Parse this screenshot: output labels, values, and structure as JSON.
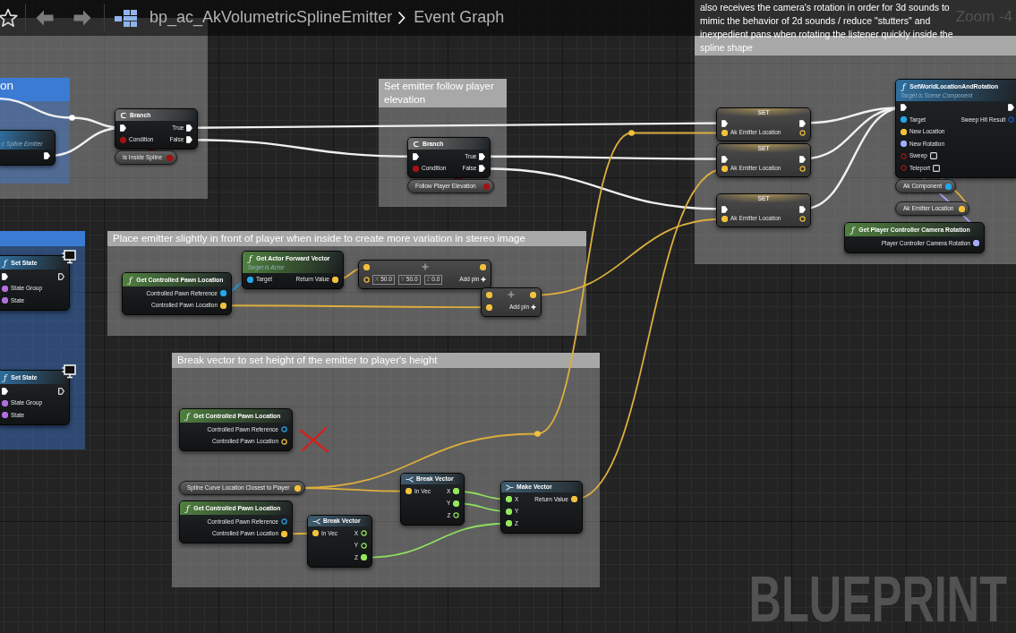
{
  "toolbar": {
    "favorite": false,
    "breadcrumb": [
      {
        "label": "bp_ac_AkVolumetricSplineEmitter"
      },
      {
        "label": "Event Graph"
      }
    ]
  },
  "zoom_level": "Zoom -4",
  "graph_type": "BLUEPRINT",
  "comments": [
    {
      "color": "#a8a8a8"
    },
    {
      "title": "on",
      "color": "#3b7bd4"
    },
    {
      "color": "#3b7bd4"
    },
    {
      "title": "Set emitter follow player elevation",
      "color": "#a8a8a8"
    },
    {
      "title": "also receives the camera's rotation in order for 3d sounds to mimic the behavior of 2d sounds / reduce \"stutters\" and inexpedient pans when rotating the listener quickly inside the spline shape",
      "color": "#a8a8a8"
    },
    {
      "title": "Place emitter slightly in front of player when inside to create more variation in stereo image",
      "color": "#a8a8a8"
    },
    {
      "title": "Break vector to set height of the emitter to player's height",
      "color": "#a8a8a8"
    }
  ],
  "nodes": [
    {
      "kind": "function",
      "subtitle": "c Spline Emitter",
      "outputs": [
        {
          "kind": "exec",
          "connected": true
        }
      ]
    },
    {
      "kind": "branch",
      "title": "Branch",
      "inputs": [
        {
          "kind": "exec",
          "connected": true
        },
        {
          "kind": "bool",
          "label": "Condition",
          "connected": true
        }
      ],
      "outputs": [
        {
          "kind": "exec",
          "label": "True",
          "connected": true
        },
        {
          "kind": "exec",
          "label": "False",
          "connected": true
        }
      ]
    },
    {
      "kind": "variable_get",
      "title": "Is Inside Spline",
      "outputs": [
        {
          "kind": "bool",
          "connected": true
        }
      ]
    },
    {
      "kind": "branch",
      "title": "Branch",
      "inputs": [
        {
          "kind": "exec",
          "connected": true
        },
        {
          "kind": "bool",
          "label": "Condition",
          "connected": true
        }
      ],
      "outputs": [
        {
          "kind": "exec",
          "label": "True",
          "connected": true
        },
        {
          "kind": "exec",
          "label": "False",
          "connected": true
        }
      ]
    },
    {
      "kind": "variable_get",
      "title": "Follow Player Elevation",
      "outputs": [
        {
          "kind": "bool",
          "connected": true
        }
      ]
    },
    {
      "kind": "variable_set",
      "title": "SET",
      "inputs": [
        {
          "kind": "exec",
          "connected": true
        },
        {
          "kind": "vector",
          "label": "Ak Emitter Location",
          "connected": true
        }
      ],
      "outputs": [
        {
          "kind": "exec",
          "connected": true
        },
        {
          "kind": "vector",
          "connected": false
        }
      ]
    },
    {
      "kind": "variable_set",
      "title": "SET",
      "inputs": [
        {
          "kind": "exec",
          "connected": true
        },
        {
          "kind": "vector",
          "label": "Ak Emitter Location",
          "connected": true
        }
      ],
      "outputs": [
        {
          "kind": "exec",
          "connected": true
        },
        {
          "kind": "vector",
          "connected": false
        }
      ]
    },
    {
      "kind": "variable_set",
      "title": "SET",
      "inputs": [
        {
          "kind": "exec",
          "connected": true
        },
        {
          "kind": "vector",
          "label": "Ak Emitter Location",
          "connected": true
        }
      ],
      "outputs": [
        {
          "kind": "exec",
          "connected": true
        },
        {
          "kind": "vector",
          "connected": false
        }
      ]
    },
    {
      "kind": "function",
      "glyph": "ƒ",
      "title": "SetWorldLocationAndRotation",
      "subtitle": "Target is Scene Component",
      "inputs": [
        {
          "kind": "exec",
          "connected": true
        },
        {
          "kind": "object",
          "label": "Target",
          "connected": true
        },
        {
          "kind": "vector",
          "label": "New Location",
          "connected": true
        },
        {
          "kind": "rotator",
          "label": "New Rotation",
          "connected": true
        },
        {
          "kind": "bool",
          "label": "Sweep",
          "connected": false,
          "checked": false
        },
        {
          "kind": "bool",
          "label": "Teleport",
          "connected": false,
          "checked": false
        }
      ],
      "outputs": [
        {
          "kind": "exec",
          "connected": true
        },
        {
          "kind": "struct",
          "label": "Sweep Hit Result",
          "connected": false
        }
      ]
    },
    {
      "kind": "variable_get",
      "title": "Ak Component",
      "outputs": [
        {
          "kind": "object",
          "connected": true
        }
      ]
    },
    {
      "kind": "variable_get",
      "title": "Ak Emitter Location",
      "outputs": [
        {
          "kind": "vector",
          "connected": true
        }
      ]
    },
    {
      "kind": "pure_function",
      "glyph": "ƒ",
      "title": "Get Player Controller Camera Rotation",
      "outputs": [
        {
          "kind": "rotator",
          "label": "Player Controller Camera Rotation",
          "connected": true
        }
      ]
    },
    {
      "kind": "function",
      "glyph": "ƒ",
      "title": "Set State",
      "monitor_badge": true,
      "inputs": [
        {
          "kind": "exec",
          "connected": true
        },
        {
          "kind": "byte",
          "label": "State Group",
          "connected": true
        },
        {
          "kind": "byte",
          "label": "State",
          "connected": true
        }
      ],
      "outputs": [
        {
          "kind": "exec",
          "connected": false
        }
      ]
    },
    {
      "kind": "function",
      "glyph": "ƒ",
      "title": "Set State",
      "monitor_badge": true,
      "inputs": [
        {
          "kind": "exec",
          "connected": true
        },
        {
          "kind": "byte",
          "label": "State Group",
          "connected": true
        },
        {
          "kind": "byte",
          "label": "State",
          "connected": true
        }
      ],
      "outputs": [
        {
          "kind": "exec",
          "connected": false
        }
      ]
    },
    {
      "kind": "pure_function",
      "glyph": "ƒ",
      "title": "Get Controlled Pawn Location",
      "outputs": [
        {
          "kind": "object",
          "label": "Controlled Pawn Reference",
          "connected": true
        },
        {
          "kind": "vector",
          "label": "Controlled Pawn Location",
          "connected": true
        }
      ]
    },
    {
      "kind": "pure_function",
      "glyph": "ƒ",
      "title": "Get Actor Forward Vector",
      "subtitle": "Target is Actor",
      "inputs": [
        {
          "kind": "object",
          "label": "Target",
          "connected": true
        }
      ],
      "outputs": [
        {
          "kind": "vector",
          "label": "Return Value",
          "connected": true
        }
      ]
    },
    {
      "kind": "operator",
      "add_pin": "Add pin",
      "inputs": [
        {
          "kind": "vector",
          "connected": true
        },
        {
          "kind": "vector",
          "connected": false,
          "defaults": [
            {
              "axis": "X",
              "value": "50.0"
            },
            {
              "axis": "Y",
              "value": "50.0"
            },
            {
              "axis": "Z",
              "value": "0.0"
            }
          ]
        }
      ],
      "outputs": [
        {
          "kind": "vector",
          "connected": true
        }
      ]
    },
    {
      "kind": "operator",
      "add_pin": "Add pin",
      "inputs": [
        {
          "kind": "vector",
          "connected": true
        },
        {
          "kind": "vector",
          "connected": true
        }
      ],
      "outputs": [
        {
          "kind": "vector",
          "connected": true
        }
      ]
    },
    {
      "kind": "pure_function",
      "glyph": "ƒ",
      "title": "Get Controlled Pawn Location",
      "crossed_out": true,
      "outputs": [
        {
          "kind": "object",
          "label": "Controlled Pawn Reference",
          "connected": false
        },
        {
          "kind": "vector",
          "label": "Controlled Pawn Location",
          "connected": false
        }
      ]
    },
    {
      "kind": "variable_get",
      "title": "Spline Curve Location Closest to Player",
      "outputs": [
        {
          "kind": "vector",
          "connected": true
        }
      ]
    },
    {
      "kind": "pure_function",
      "glyph": "ƒ",
      "title": "Get Controlled Pawn Location",
      "outputs": [
        {
          "kind": "object",
          "label": "Controlled Pawn Reference",
          "connected": false
        },
        {
          "kind": "vector",
          "label": "Controlled Pawn Location",
          "connected": true
        }
      ]
    },
    {
      "kind": "struct_break",
      "title": "Break Vector",
      "inputs": [
        {
          "kind": "vector",
          "label": "In Vec",
          "connected": true
        }
      ],
      "outputs": [
        {
          "kind": "float",
          "label": "X",
          "connected": false
        },
        {
          "kind": "float",
          "label": "Y",
          "connected": false
        },
        {
          "kind": "float",
          "label": "Z",
          "connected": true
        }
      ]
    },
    {
      "kind": "struct_break",
      "title": "Break Vector",
      "inputs": [
        {
          "kind": "vector",
          "label": "In Vec",
          "connected": true
        }
      ],
      "outputs": [
        {
          "kind": "float",
          "label": "X",
          "connected": true
        },
        {
          "kind": "float",
          "label": "Y",
          "connected": true
        },
        {
          "kind": "float",
          "label": "Z",
          "connected": false
        }
      ]
    },
    {
      "kind": "struct_make",
      "title": "Make Vector",
      "inputs": [
        {
          "kind": "float",
          "label": "X",
          "connected": true
        },
        {
          "kind": "float",
          "label": "Y",
          "connected": true
        },
        {
          "kind": "float",
          "label": "Z",
          "connected": true
        }
      ],
      "outputs": [
        {
          "kind": "vector",
          "label": "Return Value",
          "connected": true
        }
      ]
    },
    {
      "kind": "reroute",
      "outputs": [
        {
          "kind": "exec"
        }
      ]
    },
    {
      "kind": "reroute",
      "outputs": [
        {
          "kind": "vector"
        }
      ]
    },
    {
      "kind": "reroute",
      "outputs": [
        {
          "kind": "vector"
        }
      ]
    }
  ]
}
